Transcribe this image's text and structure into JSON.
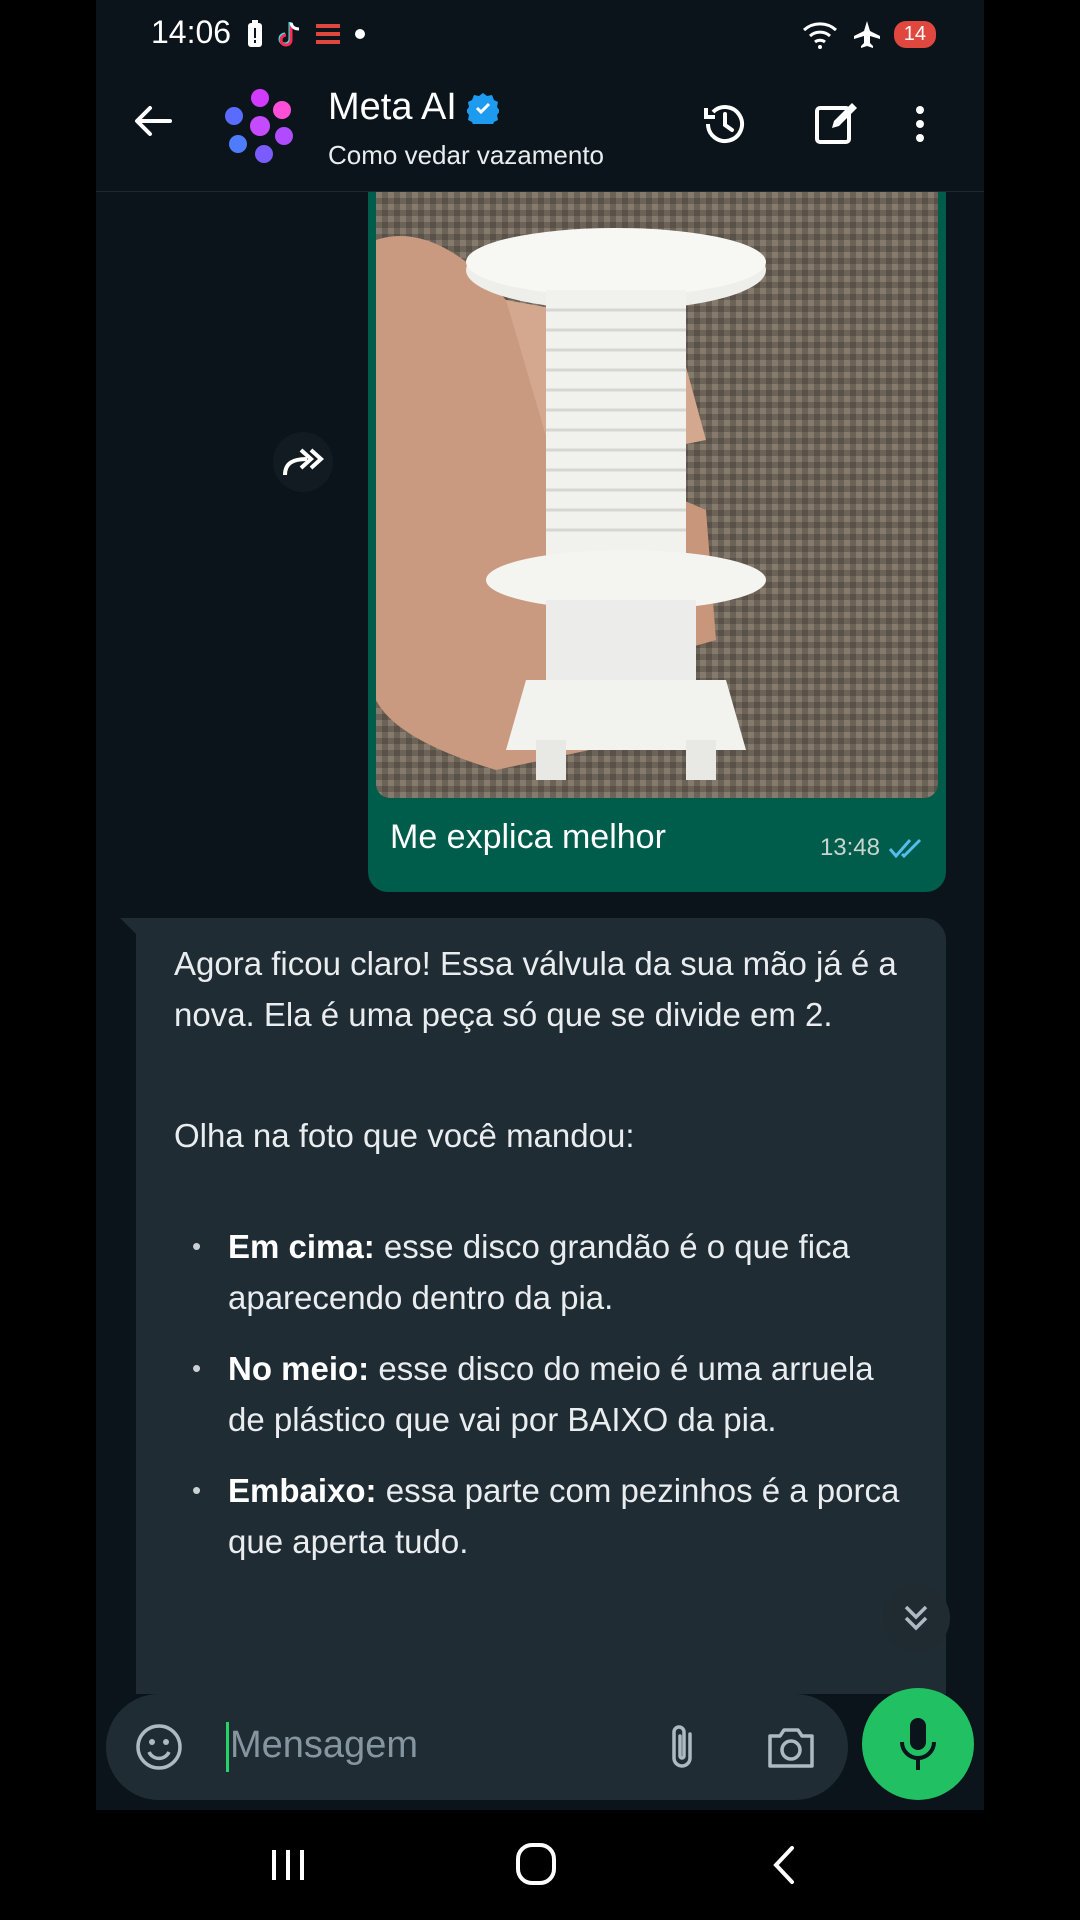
{
  "status_bar": {
    "time": "14:06",
    "battery_level": "14"
  },
  "header": {
    "title": "Meta AI",
    "subtitle": "Como vedar vazamento"
  },
  "messages": {
    "outgoing": {
      "caption": "Me explica melhor",
      "time": "13:48"
    },
    "incoming": {
      "paragraph1": "Agora ficou claro! Essa válvula da sua mão já é a nova. Ela é uma peça só que se divide em 2.",
      "paragraph2": "Olha na foto que você mandou:",
      "bullets": [
        {
          "label": "Em cima:",
          "text": " esse disco grandão é o que fica aparecendo dentro da pia."
        },
        {
          "label": "No meio:",
          "text": " esse disco do meio é uma arruela de plástico que vai por BAIXO da pia."
        },
        {
          "label": "Embaixo:",
          "text": " essa parte com pezinhos é a porca que aperta tudo."
        }
      ]
    }
  },
  "composer": {
    "placeholder": "Mensagem"
  },
  "colors": {
    "background": "#0b141a",
    "outgoing_bubble": "#005c4b",
    "incoming_bubble": "#202c33",
    "accent_green": "#21c063",
    "verified_blue": "#1d9bf0"
  }
}
